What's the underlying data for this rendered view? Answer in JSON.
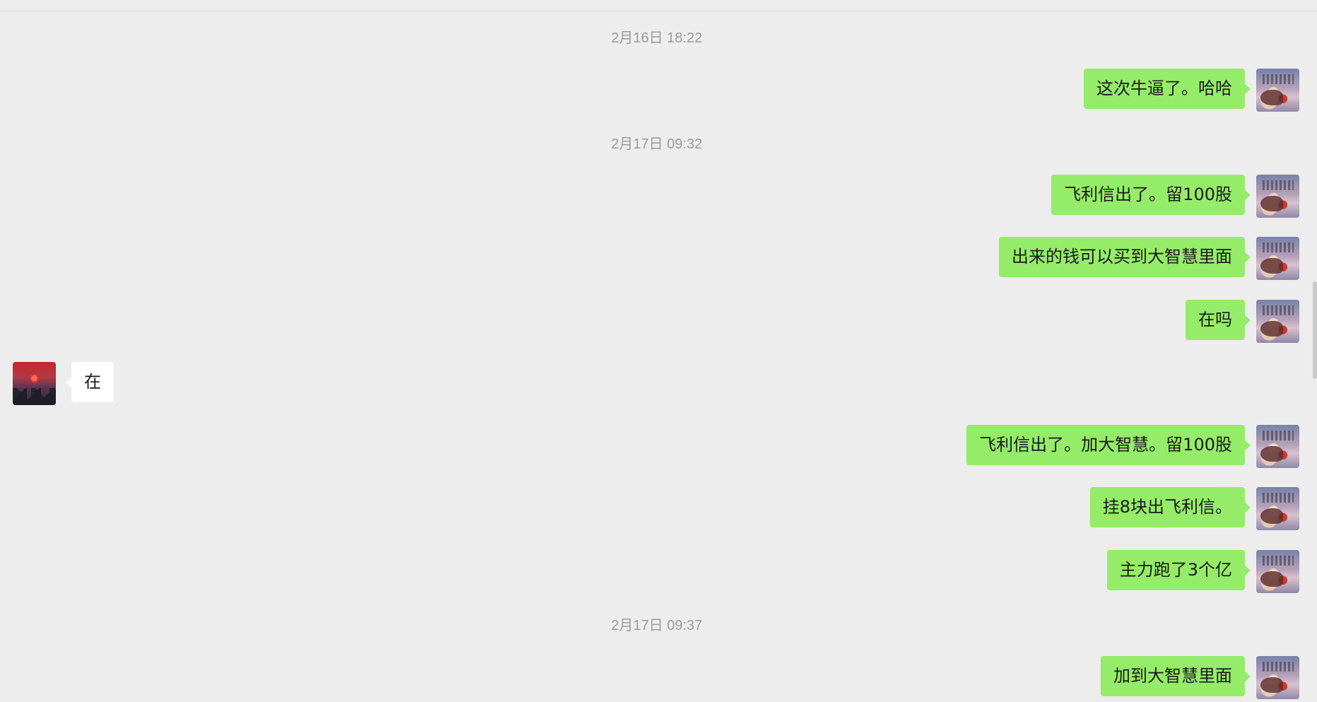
{
  "colors": {
    "background": "#ededed",
    "self_bubble": "#95ec69",
    "other_bubble": "#ffffff",
    "timestamp_text": "#9b9b9b"
  },
  "conversation": {
    "timestamps": [
      "2月16日 18:22",
      "2月17日 09:32",
      "2月17日 09:37"
    ],
    "messages": [
      {
        "sender": "self",
        "text": "这次牛逼了。哈哈"
      },
      {
        "sender": "self",
        "text": "飞利信出了。留100股"
      },
      {
        "sender": "self",
        "text": "出来的钱可以买到大智慧里面"
      },
      {
        "sender": "self",
        "text": "在吗"
      },
      {
        "sender": "other",
        "text": "在"
      },
      {
        "sender": "self",
        "text": "飞利信出了。加大智慧。留100股"
      },
      {
        "sender": "self",
        "text": "挂8块出飞利信。"
      },
      {
        "sender": "self",
        "text": "主力跑了3个亿"
      },
      {
        "sender": "self",
        "text": "加到大智慧里面"
      }
    ]
  }
}
